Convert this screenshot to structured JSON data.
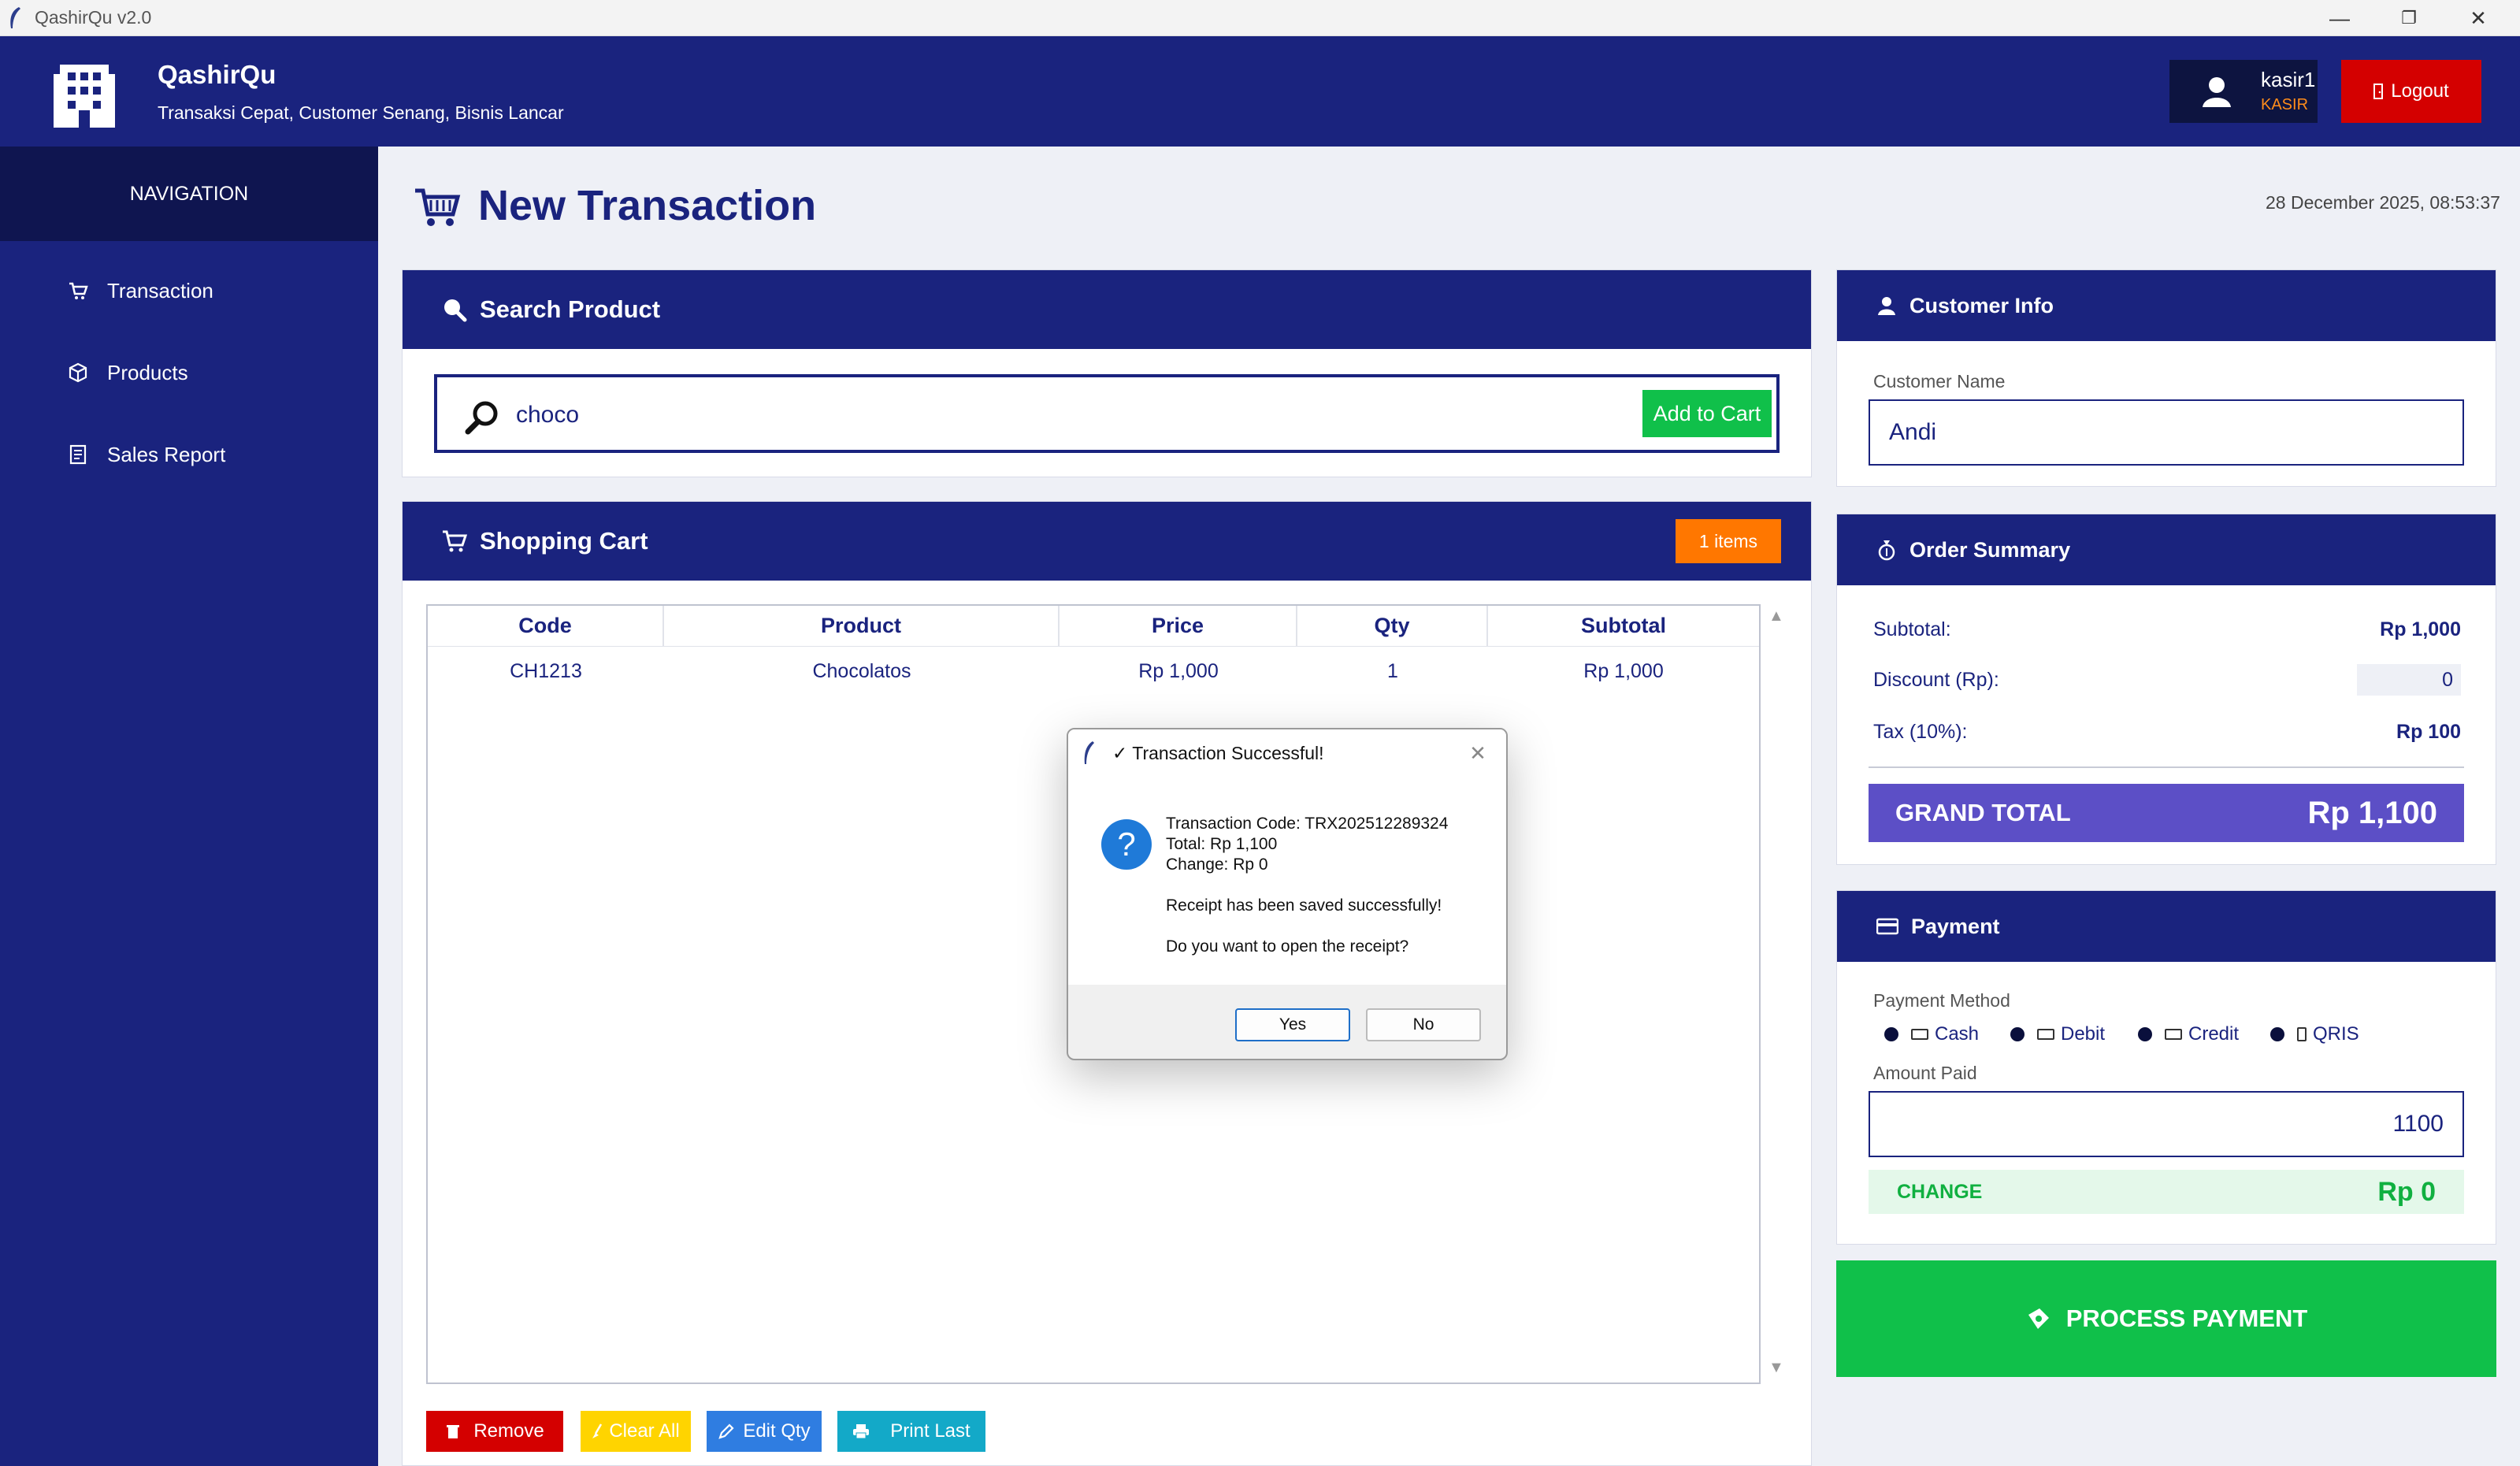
{
  "window": {
    "title": "QashirQu v2.0",
    "minimize": "—",
    "restore": "❐",
    "close": "✕"
  },
  "header": {
    "app_name": "QashirQu",
    "tagline": "Transaksi Cepat, Customer Senang, Bisnis Lancar",
    "user_name": "kasir1",
    "user_role": "KASIR",
    "logout_label": "Logout"
  },
  "sidebar": {
    "heading": "NAVIGATION",
    "items": [
      {
        "label": "Transaction",
        "icon": "cart-icon"
      },
      {
        "label": "Products",
        "icon": "box-icon"
      },
      {
        "label": "Sales Report",
        "icon": "report-icon"
      }
    ]
  },
  "page": {
    "title": "New Transaction",
    "datetime": "28 December 2025, 08:53:37"
  },
  "search": {
    "title": "Search Product",
    "value": "choco",
    "add_label": "Add to Cart"
  },
  "cart": {
    "title": "Shopping Cart",
    "items_badge": "1 items",
    "columns": [
      "Code",
      "Product",
      "Price",
      "Qty",
      "Subtotal"
    ],
    "rows": [
      {
        "code": "CH1213",
        "product": "Chocolatos",
        "price": "Rp 1,000",
        "qty": "1",
        "subtotal": "Rp 1,000"
      }
    ],
    "actions": {
      "remove": "Remove",
      "clear": "Clear All",
      "edit": "Edit Qty",
      "print": "Print Last"
    }
  },
  "customer": {
    "title": "Customer Info",
    "name_label": "Customer Name",
    "name_value": "Andi"
  },
  "summary": {
    "title": "Order Summary",
    "subtotal_label": "Subtotal:",
    "subtotal_value": "Rp 1,000",
    "discount_label": "Discount (Rp):",
    "discount_value": "0",
    "tax_label": "Tax (10%):",
    "tax_value": "Rp 100",
    "grand_label": "GRAND TOTAL",
    "grand_value": "Rp 1,100"
  },
  "payment": {
    "title": "Payment",
    "method_label": "Payment Method",
    "methods": [
      "Cash",
      "Debit",
      "Credit",
      "QRIS"
    ],
    "amount_label": "Amount Paid",
    "amount_value": "1100",
    "change_label": "CHANGE",
    "change_value": "Rp 0",
    "process_label": "PROCESS PAYMENT"
  },
  "dialog": {
    "title": "✓ Transaction Successful!",
    "line1": "Transaction Code: TRX202512289324",
    "line2": "Total: Rp 1,100",
    "line3": "Change: Rp 0",
    "line4": "Receipt has been saved successfully!",
    "line5": "Do you want to open the receipt?",
    "yes": "Yes",
    "no": "No"
  },
  "colors": {
    "navy": "#1a237e",
    "sidebar_dark": "#0f1550",
    "green": "#10c04a",
    "orange": "#ff7700",
    "red": "#d40000",
    "yellow": "#ffd400",
    "blue": "#2f7de1",
    "teal": "#13a9c8",
    "grand_total": "#5c4fc6"
  }
}
